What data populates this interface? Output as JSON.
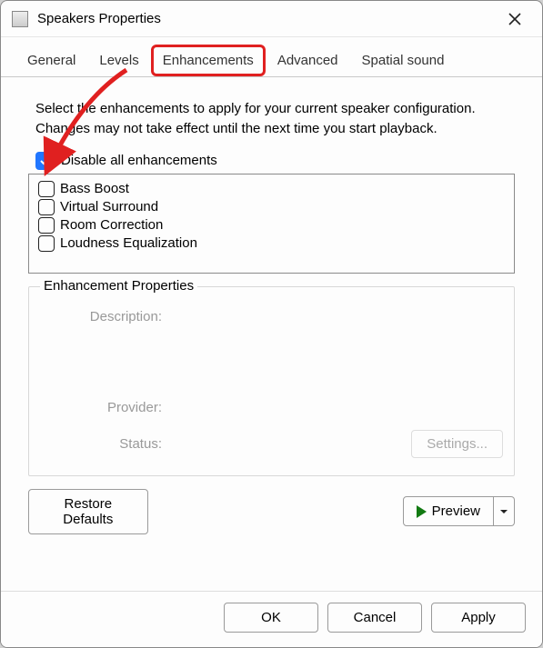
{
  "title": "Speakers Properties",
  "tabs": {
    "general": "General",
    "levels": "Levels",
    "enhancements": "Enhancements",
    "advanced": "Advanced",
    "spatial": "Spatial sound"
  },
  "intro": "Select the enhancements to apply for your current speaker configuration. Changes may not take effect until the next time you start playback.",
  "disable_label": "Disable all enhancements",
  "enhancements": {
    "items": [
      {
        "label": "Bass Boost"
      },
      {
        "label": "Virtual Surround"
      },
      {
        "label": "Room Correction"
      },
      {
        "label": "Loudness Equalization"
      }
    ]
  },
  "props": {
    "title": "Enhancement Properties",
    "description_label": "Description:",
    "provider_label": "Provider:",
    "status_label": "Status:",
    "settings_btn": "Settings..."
  },
  "restore_btn": "Restore Defaults",
  "preview_btn": "Preview",
  "footer": {
    "ok": "OK",
    "cancel": "Cancel",
    "apply": "Apply"
  }
}
